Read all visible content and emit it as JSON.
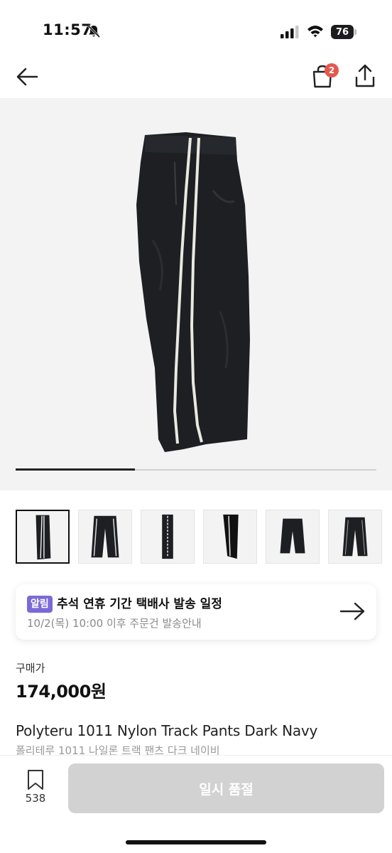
{
  "status_bar": {
    "time": "11:57",
    "battery": "76"
  },
  "nav": {
    "cart_count": "2"
  },
  "product": {
    "image_count": 6,
    "carousel_progress": 0.33
  },
  "notice": {
    "badge": "알림",
    "title": "추석 연휴 기간 택배사 발송 일정",
    "subtitle": "10/2(목) 10:00 이후 주문건 발송안내"
  },
  "price": {
    "label": "구매가",
    "value": "174,000원"
  },
  "title": {
    "en": "Polyteru 1011 Nylon Track Pants Dark Navy",
    "ko": "폴리테루 1011 나일론 트랙 팬츠 다크 네이비"
  },
  "bottom": {
    "bookmark_count": "538",
    "button_label": "일시 품절"
  },
  "colors": {
    "badge_red": "#e4584d",
    "notice_purple": "#7b6ad6",
    "disabled_button": "#d2d2d2"
  }
}
